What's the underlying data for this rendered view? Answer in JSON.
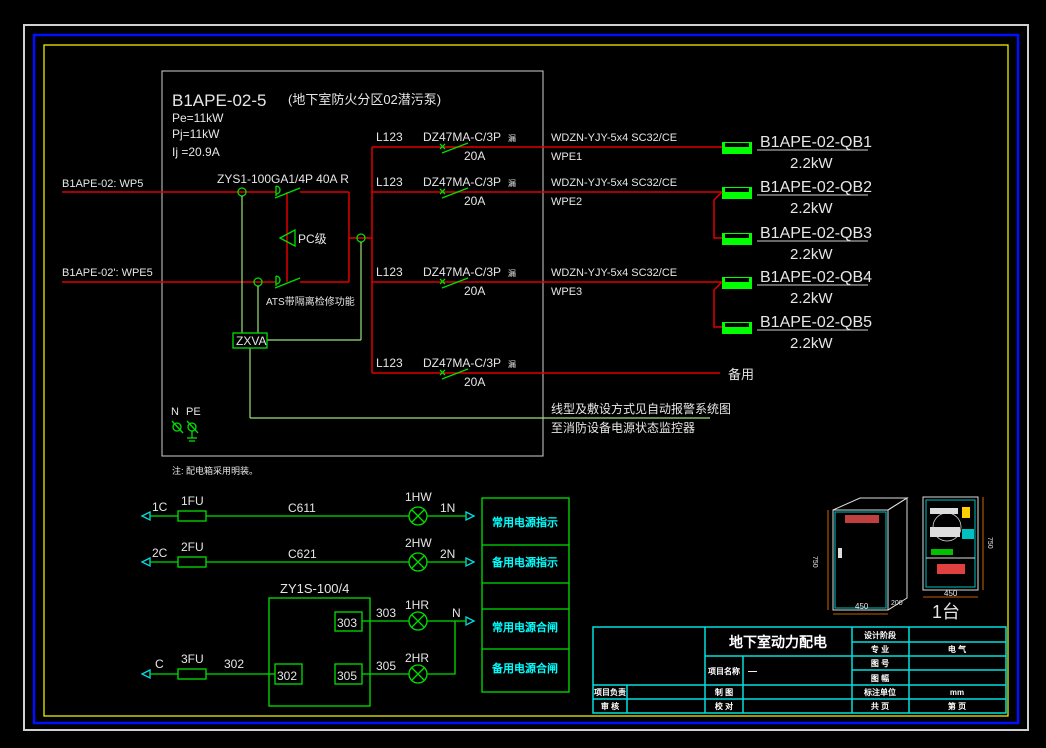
{
  "panel": {
    "id": "B1APE-02-5",
    "description": "(地下室防火分区02潜污泵)",
    "pe": "Pe=11kW",
    "pj": "Pj=11kW",
    "ij": "Ij =20.9A",
    "incoming": [
      {
        "label": "B1APE-02: WP5"
      },
      {
        "label": "B1APE-02': WPE5"
      }
    ],
    "ats_switch": "ZYS1-100GA1/4P  40A  R",
    "pc_label": "PC级",
    "ats_note": "ATS带隔离检修功能",
    "controller": "ZXVA",
    "n_label": "N",
    "pe_label": "PE"
  },
  "branches": [
    {
      "phase": "L123",
      "breaker": "DZ47MA-C/3P",
      "leak": "漏",
      "rating": "20A",
      "cable": "WDZN-YJY-5x4   SC32/CE",
      "circuit": "WPE1"
    },
    {
      "phase": "L123",
      "breaker": "DZ47MA-C/3P",
      "leak": "漏",
      "rating": "20A",
      "cable": "WDZN-YJY-5x4   SC32/CE",
      "circuit": "WPE2"
    },
    {
      "phase": "L123",
      "breaker": "DZ47MA-C/3P",
      "leak": "漏",
      "rating": "20A",
      "cable": "WDZN-YJY-5x4   SC32/CE",
      "circuit": "WPE3"
    },
    {
      "phase": "L123",
      "breaker": "DZ47MA-C/3P",
      "leak": "漏",
      "rating": "20A",
      "spare": "备用"
    }
  ],
  "loads": [
    {
      "name": "B1APE-02-QB1",
      "power": "2.2kW"
    },
    {
      "name": "B1APE-02-QB2",
      "power": "2.2kW"
    },
    {
      "name": "B1APE-02-QB3",
      "power": "2.2kW"
    },
    {
      "name": "B1APE-02-QB4",
      "power": "2.2kW"
    },
    {
      "name": "B1APE-02-QB5",
      "power": "2.2kW"
    }
  ],
  "monitor_note": [
    "线型及敷设方式见自动报警系统图",
    "至消防设备电源状态监控器"
  ],
  "install_note": "注: 配电箱采用明装。",
  "control": {
    "line1": {
      "src": "1C",
      "fuse": "1FU",
      "wire": "C611",
      "lamp": "1HW",
      "dst": "1N"
    },
    "line2": {
      "src": "2C",
      "fuse": "2FU",
      "wire": "C621",
      "lamp": "2HW",
      "dst": "2N"
    },
    "switch": "ZY1S-100/4",
    "terminals": {
      "t303": "303",
      "t305": "305",
      "t302": "302"
    },
    "line3": {
      "wire": "303",
      "lamp": "1HR",
      "dst": "N"
    },
    "line4": {
      "wire": "305",
      "lamp": "2HR"
    },
    "line5": {
      "src": "C",
      "fuse": "3FU",
      "wire": "302"
    },
    "legend": [
      "常用电源指示",
      "备用电源指示",
      "",
      "常用电源合闸",
      "备用电源合闸"
    ]
  },
  "cabinet": {
    "width": "450",
    "depth": "200",
    "height": "750",
    "count": "1台"
  },
  "title_block": {
    "title": "地下室动力配电",
    "project_name_label": "项目名称",
    "project_name_value": "—",
    "design_stage": "设计阶段",
    "discipline_label": "专   业",
    "discipline_value": "电 气",
    "drawing_no": "图   号",
    "sheet_size": "图   幅",
    "unit_label": "标注单位",
    "unit_value": "mm",
    "project_lead": "项目负责",
    "drawn": "制   图",
    "review": "审   核",
    "check": "校   对",
    "total_pages": "共     页",
    "page_no": "第     页"
  },
  "colors": {
    "power": "#e00000",
    "control": "#00e000",
    "frame_blue": "#0000ff",
    "frame_yellow": "#ffff00",
    "title_block": "#00e0e0"
  }
}
